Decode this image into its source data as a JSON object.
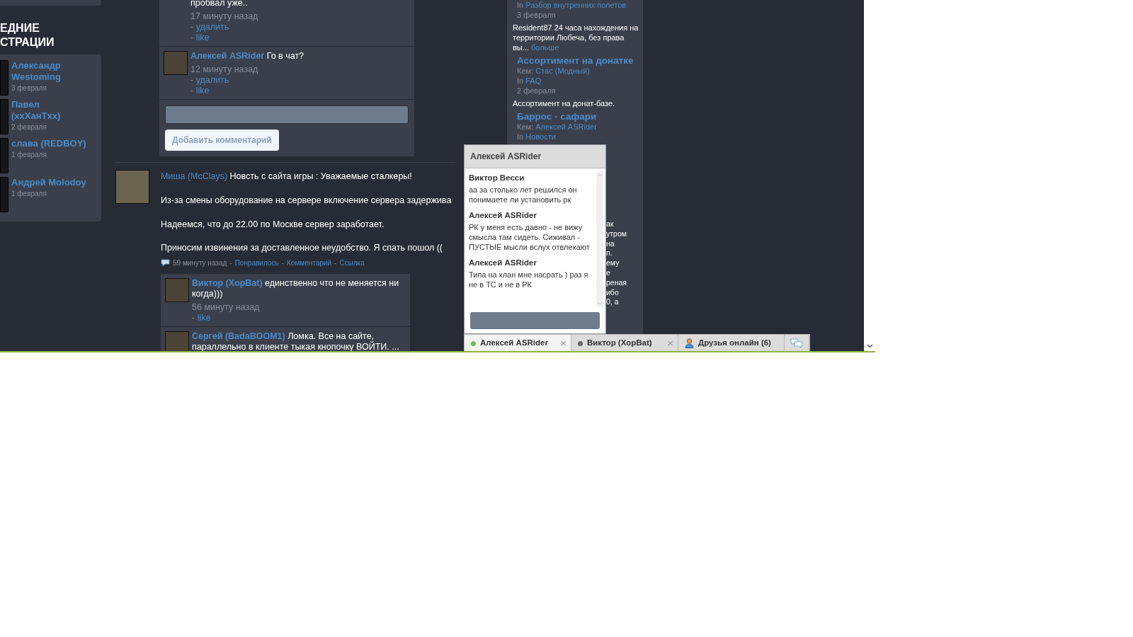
{
  "sidebar": {
    "heading_lines": [
      "ЕДНИЕ",
      "СТРАЦИИ"
    ],
    "users": [
      {
        "name": "Александр Westoming",
        "date": "3 февраля"
      },
      {
        "name": "Павел (xxХанТxx)",
        "date": "2 февраля"
      },
      {
        "name": "слава (REDBOY)",
        "date": "1 февраля"
      },
      {
        "name": "Андрей Molodoy",
        "date": "1 февраля"
      }
    ]
  },
  "top_comments": [
    {
      "text": "пробвал уже..",
      "time": "17 минуту назад",
      "actions": [
        {
          "prefix": "-",
          "label": "удалить"
        },
        {
          "prefix": "-",
          "label": "like"
        }
      ]
    },
    {
      "author": "Алексей ASRider",
      "text": "Го в чат?",
      "time": "12 минуту назад",
      "actions": [
        {
          "prefix": "-",
          "label": "удалить"
        },
        {
          "prefix": "-",
          "label": "like"
        }
      ]
    }
  ],
  "comment_form": {
    "button": "Добавить комментарий"
  },
  "post": {
    "author": "Миша (McClays)",
    "title": "Новсть с сайта игры : Уважаемые сталкеры!",
    "paragraphs": [
      "Из-за смены оборудование на сервере включение сервера задерживa",
      "Надеемся, что до 22.00 по Москве сервер заработает.",
      "Приносим извинения за доставленное неудобство. Я спать пошол (("
    ],
    "meta": {
      "time": "59 минуту назад",
      "separator": "-",
      "links": [
        "Понравилось",
        "Комментарий",
        "Ссылка"
      ]
    }
  },
  "replies": [
    {
      "author": "Виктор (ХорBat)",
      "text": "единственно что не меняется ни когда)))",
      "time": "56 минуту назад",
      "actions": [
        {
          "prefix": "-",
          "label": "like"
        }
      ]
    },
    {
      "author": "Сергей (BadaBOOM1)",
      "text": "Ломка. Все на сайте, параллельно в клиенте тыкая кнопочку ВОЙТИ. ..."
    }
  ],
  "topics": [
    {
      "in_label": "In",
      "in": "Разбор внутренних полетов",
      "date": "3 февраля",
      "excerpt": "Resident87 24 часа нахождения на территории Любеча, без права вы...",
      "more": "больше"
    },
    {
      "title": "Ассортимент на донатке",
      "by_label": "Кем:",
      "by": "Стас (Модный)",
      "in_label": "In",
      "in": "FAQ",
      "date": "2 февраля",
      "excerpt": "Ассортимент на донат-базе."
    },
    {
      "title": "Баррос - сафари",
      "by_label": "Кем:",
      "by": "Алексей ASRider",
      "in_label": "In",
      "in": "Новости"
    }
  ],
  "topic_fragments": [
    "ак",
    "утром",
    "на",
    "п.",
    "ему",
    "е",
    "реная",
    "ибо",
    "0, а"
  ],
  "chat": {
    "title": "Алексей ASRider",
    "messages": [
      {
        "author": "Виктор Весси",
        "text": "аа за столько лет решился он понимаете ли установить рк"
      },
      {
        "author": "Алексей ASRider",
        "text": "РК у меня есть давно - не вижу смысла там сидеть. Сиживал - ПУСТЫЕ мысли вслух отвлекают"
      },
      {
        "author": "Алексей ASRider",
        "text": "Типа на клан мне насрать ) раз я не в ТС и не в РК"
      }
    ]
  },
  "chat_bar": [
    {
      "kind": "chat",
      "label": "Алексей ASRider",
      "online": true,
      "selected": true,
      "close": "×"
    },
    {
      "kind": "chat",
      "label": "Виктор (ХорBat)",
      "online": false,
      "selected": false,
      "close": "×"
    },
    {
      "kind": "friends",
      "label": "Друзья онлайн (6)"
    },
    {
      "kind": "messages"
    }
  ]
}
